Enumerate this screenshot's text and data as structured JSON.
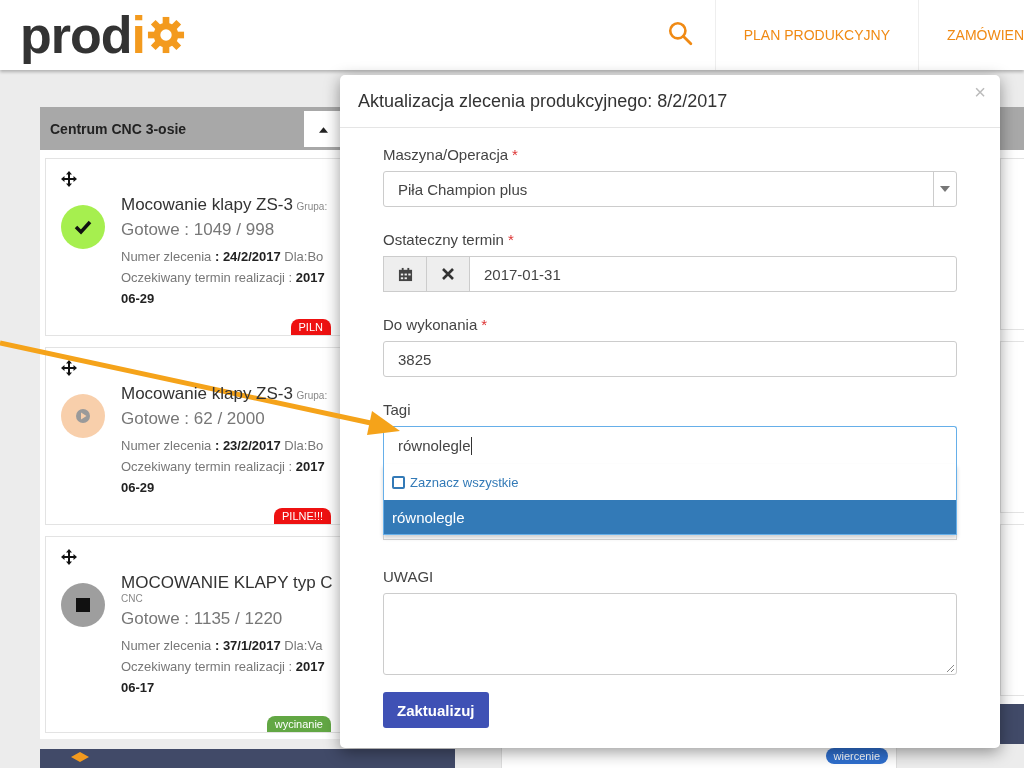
{
  "header": {
    "logo": {
      "text": "prod",
      "accent": "i"
    },
    "nav": [
      {
        "label": "PLAN PRODUKCYJNY"
      },
      {
        "label": "ZAMÓWIEN"
      }
    ]
  },
  "board": {
    "left_column": {
      "title": "Centrum CNC 3-osie",
      "cards": [
        {
          "kind": "done",
          "title": "Mocowanie klapy ZS-3",
          "group": "Grupa:",
          "done": "Gotowe : 1049 / 998",
          "order": "Numer zlecenia **: 24/2/2017** Dla:Bo",
          "due": "Oczekiwany termin realizacji : **2017**",
          "due_tail": "06-29",
          "badge": {
            "text": "PILN",
            "color": "#ee1111"
          }
        },
        {
          "kind": "running",
          "title": "Mocowanie klapy ZS-3",
          "group": "Grupa:",
          "done": "Gotowe : 62 / 2000",
          "order": "Numer zlecenia **: 23/2/2017** Dla:Bo",
          "due": "Oczekiwany termin realizacji : **2017**",
          "due_tail": "06-29",
          "badge": {
            "text": "PILNE!!!",
            "color": "#ee1111"
          }
        },
        {
          "kind": "stopped",
          "title": "MOCOWANIE KLAPY typ C",
          "group_below": "CNC",
          "done": "Gotowe : 1135 / 1220",
          "order": "Numer zlecenia **: 37/1/2017** Dla:Va",
          "due": "Oczekiwany termin realizacji : **2017**",
          "due_tail": "06-17",
          "badge": {
            "text": "wycinanie",
            "color": "#62a744"
          }
        }
      ]
    },
    "middle_column": {
      "badge": {
        "text": "wiercenie",
        "color": "#2f6fce"
      }
    }
  },
  "modal": {
    "title": "Aktualizacja zlecenia produkcyjnego: 8/2/2017",
    "close": "×",
    "fields": [
      {
        "kind": "select",
        "label": "Maszyna/Operacja",
        "required_mark": "*",
        "value": "Piła Champion plus"
      },
      {
        "kind": "date",
        "label": "Ostateczny termin",
        "required_mark": "*",
        "value": "2017-01-31"
      },
      {
        "kind": "text",
        "label": "Do wykonania",
        "required_mark": "*",
        "value": "3825"
      },
      {
        "kind": "tags",
        "label": "Tagi",
        "search": "równolegle",
        "select_all": {
          "label": "Zaznacz wszystkie",
          "checked": false
        },
        "options": [
          {
            "label": "równolegle",
            "selected": true
          }
        ]
      },
      {
        "kind": "textarea",
        "label": "UWAGI"
      }
    ],
    "submit": "Zaktualizuj"
  }
}
